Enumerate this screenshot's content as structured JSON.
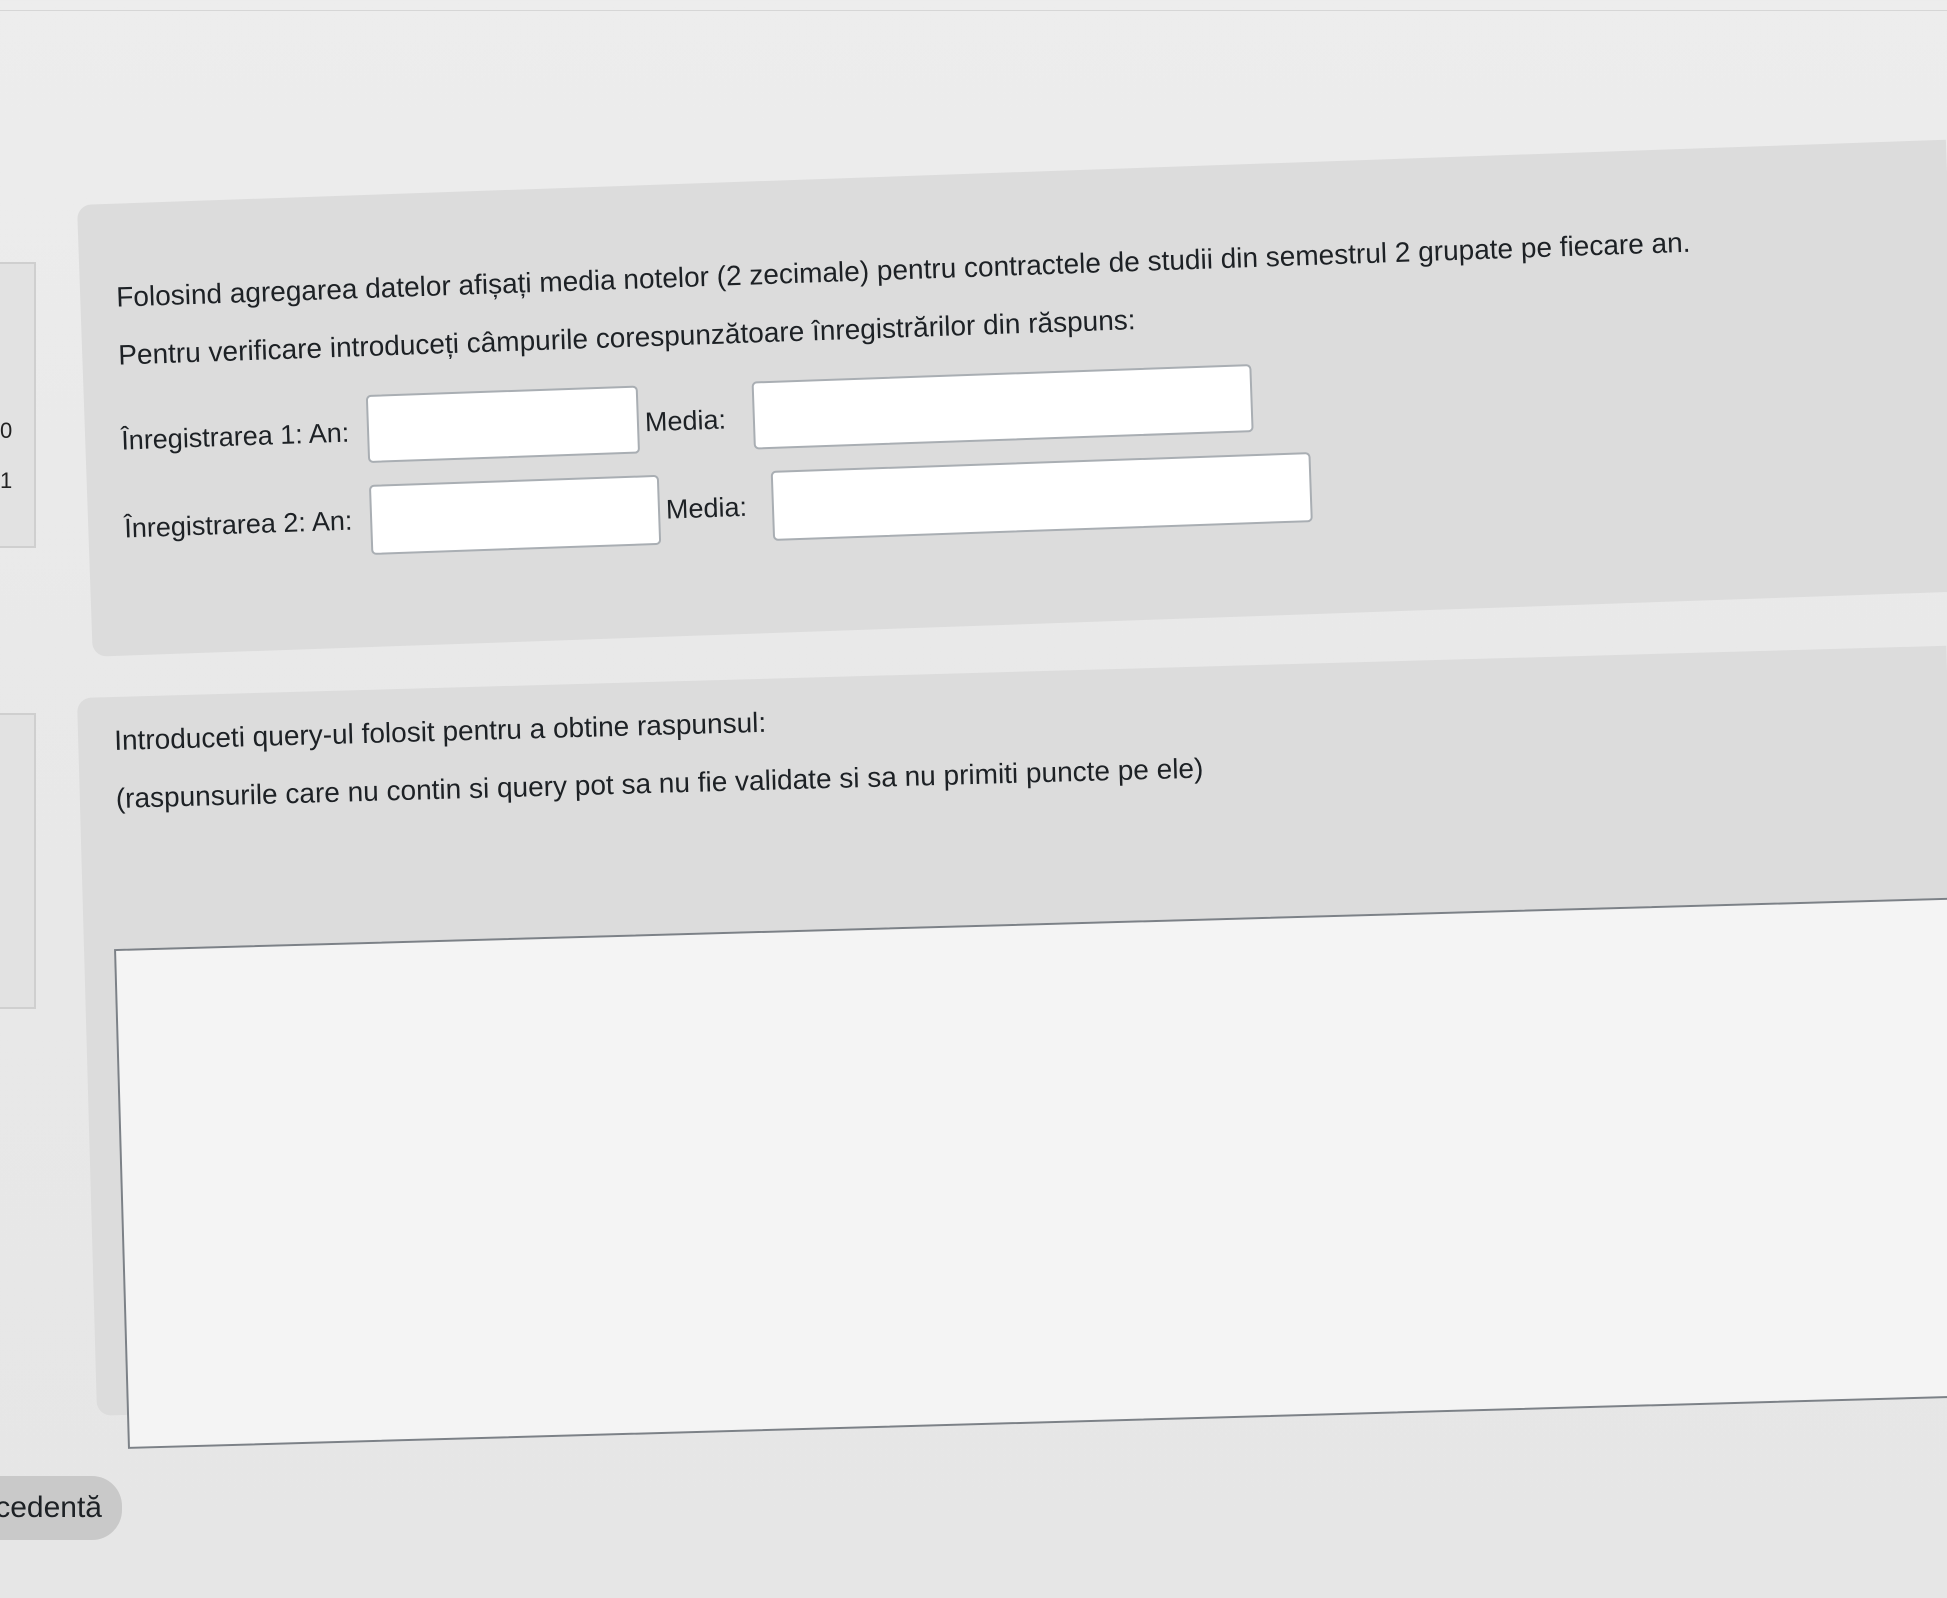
{
  "question1": {
    "intro": "Folosind agregarea datelor afișați media notelor (2 zecimale) pentru contractele de studii din semestrul 2 grupate pe fiecare an.",
    "instruction": "Pentru verificare introduceți câmpurile corespunzătoare înregistrărilor din răspuns:",
    "rows": [
      {
        "record_label": "Înregistrarea 1: An:",
        "media_label": "Media:",
        "an_value": "",
        "media_value": ""
      },
      {
        "record_label": "Înregistrarea 2: An:",
        "media_label": "Media:",
        "an_value": "",
        "media_value": ""
      }
    ]
  },
  "question2": {
    "prompt": "Introduceti query-ul folosit pentru a obtine raspunsul:",
    "note": "(raspunsurile care nu contin si query pot sa nu fie validate si sa nu primiti puncte pe ele)",
    "answer_value": ""
  },
  "side_cards": {
    "q1_number_top": "0",
    "q1_number_bottom": "1"
  },
  "navigation": {
    "previous_label": "cedentă"
  }
}
